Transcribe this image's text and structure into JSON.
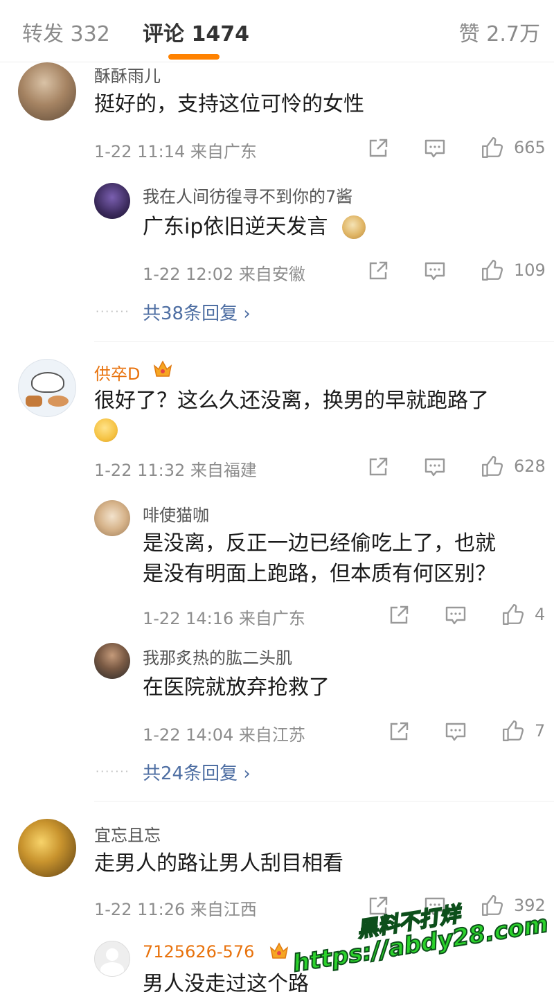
{
  "tabs": {
    "repost": "转发 332",
    "comments": "评论 1474",
    "likes": "赞 2.7万"
  },
  "comments": [
    {
      "user": "酥酥雨儿",
      "text": "挺好的，支持这位可怜的女性",
      "meta": "1-22 11:14 来自广东",
      "likes": "665",
      "replies": [
        {
          "user": "我在人间彷徨寻不到你的7酱",
          "text": "广东ip依旧逆天发言",
          "meta": "1-22 12:02 来自安徽",
          "likes": "109"
        }
      ],
      "more": "共38条回复 ›"
    },
    {
      "user": "供卒D",
      "text_line1": "很好了？这么久还没离，换男的早就跑路了",
      "meta": "1-22 11:32 来自福建",
      "likes": "628",
      "replies": [
        {
          "user": "啡使猫咖",
          "text_line1": "是没离，反正一边已经偷吃上了，也就",
          "text_line2": "是没有明面上跑路，但本质有何区别？",
          "meta": "1-22 14:16 来自广东",
          "likes": "4"
        },
        {
          "user": "我那炙热的肱二头肌",
          "text": "在医院就放弃抢救了",
          "meta": "1-22 14:04 来自江苏",
          "likes": "7"
        }
      ],
      "more": "共24条回复 ›"
    },
    {
      "user": "宜忘且忘",
      "text": "走男人的路让男人刮目相看",
      "meta": "1-22 11:26 来自江西",
      "likes": "392",
      "replies": [
        {
          "user": "7125626-576",
          "text": "男人没走过这个路"
        }
      ]
    }
  ],
  "dots": "·······",
  "watermark": {
    "line1": "黑料不打烊",
    "line2": "https://abdy28.com"
  },
  "colors": {
    "accent": "#ff8200",
    "link": "#4f6fa3",
    "vip_name": "#e8720c",
    "watermark": "#2bd22b"
  }
}
